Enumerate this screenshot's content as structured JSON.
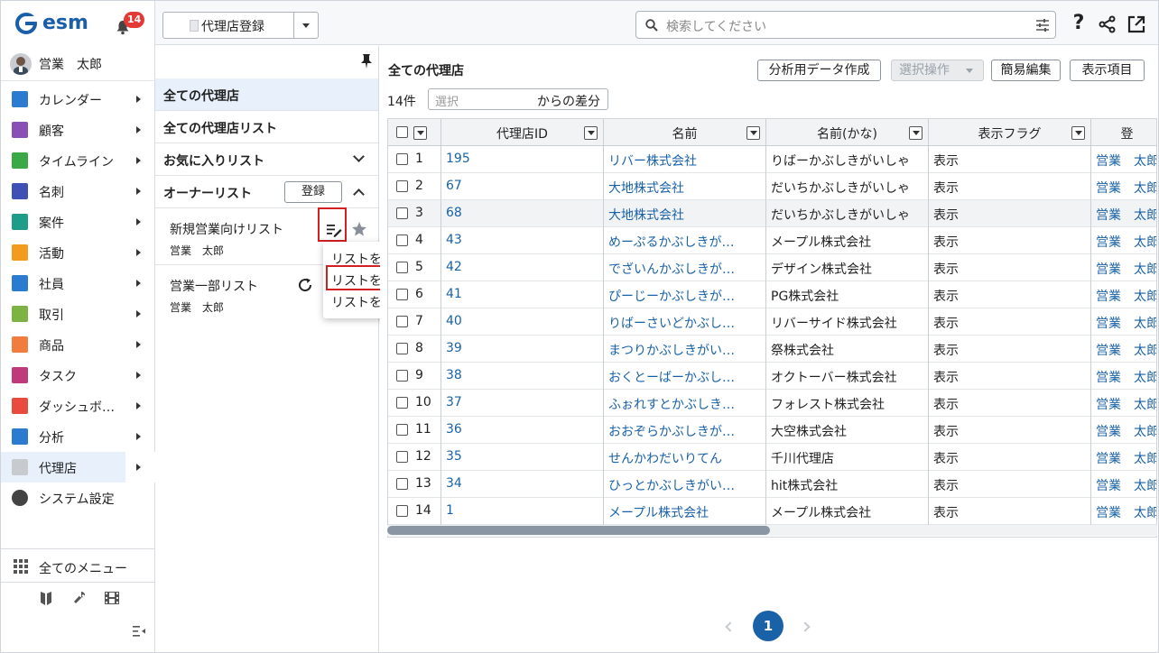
{
  "app": {
    "logo_text": "esm",
    "notification_count": "14"
  },
  "user": {
    "name": "営業　太郎"
  },
  "sidebar": {
    "items": [
      {
        "label": "カレンダー",
        "icon": "calendar-icon",
        "color": "#2b7bd1"
      },
      {
        "label": "顧客",
        "icon": "building-icon",
        "color": "#8a4fb5"
      },
      {
        "label": "タイムライン",
        "icon": "chat-icon",
        "color": "#3aa845"
      },
      {
        "label": "名刺",
        "icon": "card-icon",
        "color": "#3f51b5"
      },
      {
        "label": "案件",
        "icon": "folder-icon",
        "color": "#1e9c8a"
      },
      {
        "label": "活動",
        "icon": "clipboard-icon",
        "color": "#f29b1d"
      },
      {
        "label": "社員",
        "icon": "person-icon",
        "color": "#2b7bd1"
      },
      {
        "label": "取引",
        "icon": "deal-icon",
        "color": "#7cb342"
      },
      {
        "label": "商品",
        "icon": "box-icon",
        "color": "#f07c3e"
      },
      {
        "label": "タスク",
        "icon": "task-icon",
        "color": "#c0397a"
      },
      {
        "label": "ダッシュボ…",
        "icon": "dashboard-icon",
        "color": "#e84a3d"
      },
      {
        "label": "分析",
        "icon": "chart-icon",
        "color": "#2b7bd1"
      },
      {
        "label": "代理店",
        "icon": "document-icon",
        "color": "#c7cbd0"
      },
      {
        "label": "システム設定",
        "icon": "gear-icon",
        "color": "#444444"
      }
    ],
    "all_menu": "全てのメニュー"
  },
  "topbar": {
    "register_label": "代理店登録",
    "search_placeholder": "検索してください"
  },
  "list_panel": {
    "all_agencies": "全ての代理店",
    "all_lists": "全ての代理店リスト",
    "favorites": "お気に入りリスト",
    "owner_lists": "オーナーリスト",
    "register_btn": "登録",
    "lists": [
      {
        "title": "新規営業向けリスト",
        "owner": "営業　太郎"
      },
      {
        "title": "営業一部リスト",
        "owner": "営業　太郎"
      }
    ],
    "context_menu": [
      "リストを編集",
      "リストを複製",
      "リストを削除"
    ]
  },
  "main": {
    "title": "全ての代理店",
    "actions": {
      "export": "分析用データ作成",
      "select_ops": "選択操作",
      "quick_edit": "簡易編集",
      "display_items": "表示項目"
    },
    "count": "14件",
    "diff_placeholder": "選択",
    "diff_label": "からの差分",
    "columns": [
      "代理店ID",
      "名前",
      "名前(かな)",
      "表示フラグ",
      "登"
    ],
    "rows": [
      {
        "n": "1",
        "id": "195",
        "name": "リバー株式会社",
        "kana": "りばーかぶしきがいしゃ",
        "flag": "表示",
        "reg": "営業　太郎"
      },
      {
        "n": "2",
        "id": "67",
        "name": "大地株式会社",
        "kana": "だいちかぶしきがいしゃ",
        "flag": "表示",
        "reg": "営業　太郎"
      },
      {
        "n": "3",
        "id": "68",
        "name": "大地株式会社",
        "kana": "だいちかぶしきがいしゃ",
        "flag": "表示",
        "reg": "営業　太郎"
      },
      {
        "n": "4",
        "id": "43",
        "name": "めーぷるかぶしきが…",
        "kana": "メープル株式会社",
        "flag": "表示",
        "reg": "営業　太郎"
      },
      {
        "n": "5",
        "id": "42",
        "name": "でざいんかぶしきが…",
        "kana": "デザイン株式会社",
        "flag": "表示",
        "reg": "営業　太郎"
      },
      {
        "n": "6",
        "id": "41",
        "name": "ぴーじーかぶしきが…",
        "kana": "PG株式会社",
        "flag": "表示",
        "reg": "営業　太郎"
      },
      {
        "n": "7",
        "id": "40",
        "name": "りばーさいどかぶし…",
        "kana": "リバーサイド株式会社",
        "flag": "表示",
        "reg": "営業　太郎"
      },
      {
        "n": "8",
        "id": "39",
        "name": "まつりかぶしきがい…",
        "kana": "祭株式会社",
        "flag": "表示",
        "reg": "営業　太郎"
      },
      {
        "n": "9",
        "id": "38",
        "name": "おくとーばーかぶし…",
        "kana": "オクトーバー株式会社",
        "flag": "表示",
        "reg": "営業　太郎"
      },
      {
        "n": "10",
        "id": "37",
        "name": "ふぉれすとかぶしき…",
        "kana": "フォレスト株式会社",
        "flag": "表示",
        "reg": "営業　太郎"
      },
      {
        "n": "11",
        "id": "36",
        "name": "おおぞらかぶしきが…",
        "kana": "大空株式会社",
        "flag": "表示",
        "reg": "営業　太郎"
      },
      {
        "n": "12",
        "id": "35",
        "name": "せんかわだいりてん",
        "kana": "千川代理店",
        "flag": "表示",
        "reg": "営業　太郎"
      },
      {
        "n": "13",
        "id": "34",
        "name": "ひっとかぶしきがい…",
        "kana": "hit株式会社",
        "flag": "表示",
        "reg": "営業　太郎"
      },
      {
        "n": "14",
        "id": "1",
        "name": "メープル株式会社",
        "kana": "メープル株式会社",
        "flag": "表示",
        "reg": "営業　太郎"
      }
    ],
    "page": "1"
  }
}
